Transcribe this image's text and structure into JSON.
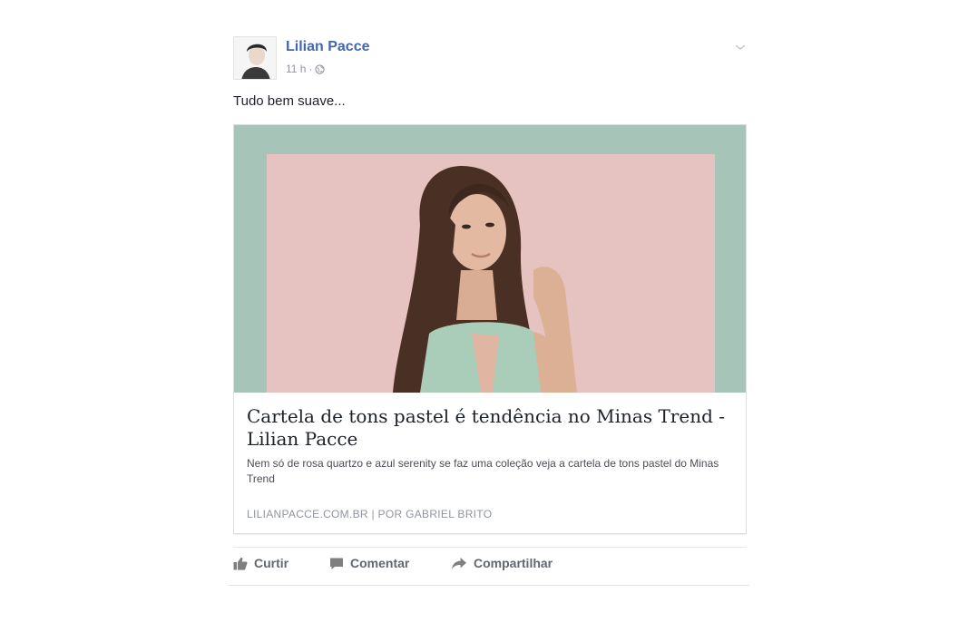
{
  "post": {
    "author": "Lilian Pacce",
    "time": "11 h",
    "separator": "·",
    "privacy_icon": "globe-icon",
    "status": "Tudo bem suave..."
  },
  "link_card": {
    "title": "Cartela de tons pastel é tendência no Minas Trend - Lilian Pacce",
    "description": "Nem só de rosa quartzo e azul serenity se faz uma coleção veja a cartela de tons pastel do Minas Trend",
    "source": "LILIANPACCE.COM.BR | POR GABRIEL BRITO"
  },
  "actions": [
    {
      "label": "Curtir",
      "icon": "thumbs-up-icon"
    },
    {
      "label": "Comentar",
      "icon": "comment-icon"
    },
    {
      "label": "Compartilhar",
      "icon": "share-icon"
    }
  ],
  "colors": {
    "author_link": "#4267b2",
    "image_mint": "#a6c4b8",
    "image_pink": "#e6c3c0",
    "action_text": "#606770"
  }
}
